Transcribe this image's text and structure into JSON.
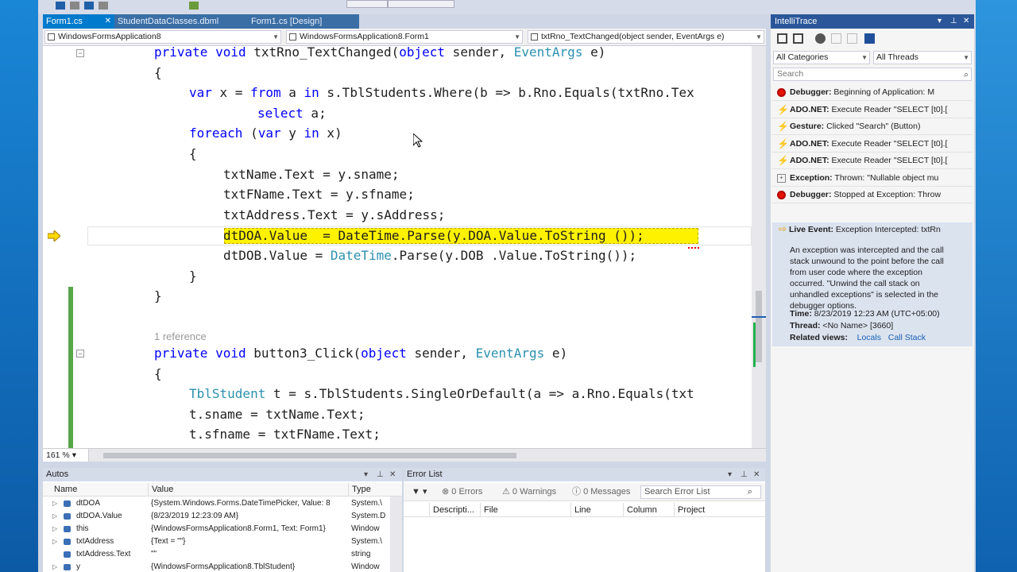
{
  "tabs": [
    {
      "label": "Form1.cs",
      "pin": "✕",
      "active": true
    },
    {
      "label": "StudentDataClasses.dbml",
      "active": false
    },
    {
      "label": "Form1.cs [Design]",
      "active": false
    }
  ],
  "nav": {
    "project": "WindowsFormsApplication8",
    "klass": "WindowsFormsApplication8.Form1",
    "member": "txtRno_TextChanged(object sender, EventArgs e)"
  },
  "code": {
    "l1": {
      "kw": "private void",
      "rest": " txtRno_TextChanged(",
      "kw2": "object",
      "mid": " sender, ",
      "ty": "EventArgs",
      "end": " e)"
    },
    "brace_open": "{",
    "l3": {
      "kw": "var",
      "mid": " x = ",
      "kw2": "from",
      "mid2": " a ",
      "kw3": "in",
      "end": " s.TblStudents.Where(b => b.Rno.Equals(txtRno.Tex"
    },
    "l4": {
      "kw": "select",
      "end": " a;"
    },
    "l5": {
      "kw": "foreach",
      "mid": " (",
      "kw2": "var",
      "mid2": " y ",
      "kw3": "in",
      "end": " x)"
    },
    "l6": "{",
    "l7": "txtName.Text = y.sname;",
    "l8": "txtFName.Text = y.sfname;",
    "l9": "txtAddress.Text = y.sAddress;",
    "l10": "dtDOA.Value  = DateTime.Parse(y.DOA.Value.ToString ());",
    "l11": {
      "pre": "dtDOB.Value = ",
      "ty": "DateTime",
      "end": ".Parse(y.DOB .Value.ToString());"
    },
    "l12": "}",
    "l13": "}",
    "reference": "1 reference",
    "l14": {
      "kw": "private void",
      "rest": " button3_Click(",
      "kw2": "object",
      "mid": " sender, ",
      "ty": "EventArgs",
      "end": " e)"
    },
    "l15": "{",
    "l16": {
      "ty": "TblStudent",
      "end": " t = s.TblStudents.SingleOrDefault(a => a.Rno.Equals(txt"
    },
    "l17": "t.sname = txtName.Text;",
    "l18": "t.sfname = txtFName.Text;"
  },
  "zoom": "161 %",
  "intellitrace": {
    "title": "IntelliTrace",
    "categories": "All Categories",
    "threads": "All Threads",
    "search_placeholder": "Search",
    "events": [
      {
        "kind": "Debugger:",
        "text": " Beginning of Application: M",
        "icon": "stop"
      },
      {
        "kind": "ADO.NET:",
        "text": " Execute Reader \"SELECT [t0].[",
        "icon": "bolt"
      },
      {
        "kind": "Gesture:",
        "text": " Clicked \"Search\" (Button)",
        "icon": "bolt"
      },
      {
        "kind": "ADO.NET:",
        "text": " Execute Reader \"SELECT [t0].[",
        "icon": "bolt"
      },
      {
        "kind": "ADO.NET:",
        "text": " Execute Reader \"SELECT [t0].[",
        "icon": "bolt"
      },
      {
        "kind": "Exception:",
        "text": " Thrown: \"Nullable object mu",
        "icon": "exc"
      },
      {
        "kind": "Debugger:",
        "text": " Stopped at Exception: Throw",
        "icon": "stop"
      }
    ],
    "selected": {
      "kind": "Live Event:",
      "text": " Exception Intercepted: txtRn",
      "description": "An exception was intercepted and the call stack unwound to the point before the call from user code where the exception occurred. \"Unwind the call stack on unhandled exceptions\" is selected in the debugger options.",
      "time_label": "Time:",
      "time_value": " 8/23/2019 12:23 AM (UTC+05:00)",
      "thread_label": "Thread:",
      "thread_value": " <No Name> [3660]",
      "related_label": "Related views:",
      "link_locals": "Locals",
      "link_callstack": "Call Stack"
    }
  },
  "autos": {
    "title": "Autos",
    "cols": [
      "Name",
      "Value",
      "Type"
    ],
    "rows": [
      {
        "name": "dtDOA",
        "value": "{System.Windows.Forms.DateTimePicker, Value: 8",
        "type": "System.\\"
      },
      {
        "name": "dtDOA.Value",
        "value": "{8/23/2019 12:23:09 AM}",
        "type": "System.D"
      },
      {
        "name": "this",
        "value": "{WindowsFormsApplication8.Form1, Text: Form1}",
        "type": "Window"
      },
      {
        "name": "txtAddress",
        "value": "{Text = \"\"}",
        "type": "System.\\"
      },
      {
        "name": "txtAddress.Text",
        "value": "\"\"",
        "type": "string"
      },
      {
        "name": "y",
        "value": "{WindowsFormsApplication8.TblStudent}",
        "type": "Window"
      }
    ]
  },
  "errors": {
    "title": "Error List",
    "errors": "0 Errors",
    "warnings": "0 Warnings",
    "messages": "0 Messages",
    "search_placeholder": "Search Error List",
    "cols": [
      "Descripti...",
      "File",
      "Line",
      "Column",
      "Project"
    ]
  },
  "colors": {
    "accent": "#007acc",
    "highlight": "#fff200",
    "keyword": "#0000ff",
    "type": "#2b91af"
  }
}
